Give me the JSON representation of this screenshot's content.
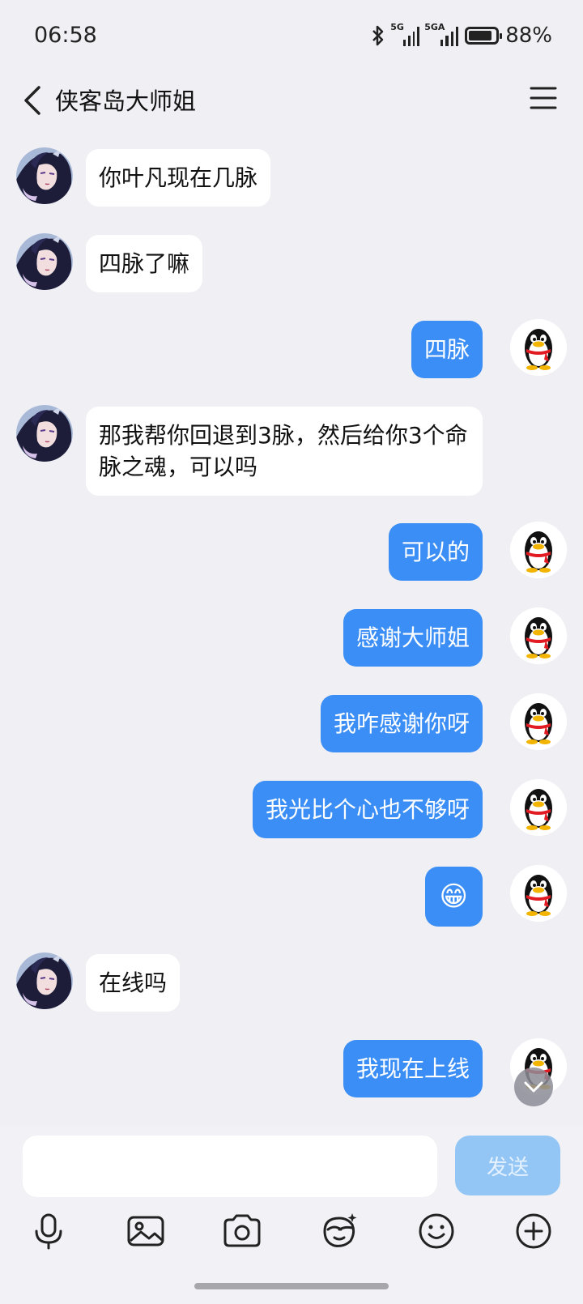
{
  "status_bar": {
    "time": "06:58",
    "signal1_label": "5G",
    "signal2_label": "5GA",
    "battery": "88%",
    "battery_level": 0.88
  },
  "header": {
    "title": "侠客岛大师姐",
    "back_icon": "chevron-left-icon",
    "menu_icon": "hamburger-menu-icon"
  },
  "messages": [
    {
      "side": "in",
      "text": "你叶凡现在几脉"
    },
    {
      "side": "in",
      "text": "四脉了嘛"
    },
    {
      "side": "out",
      "text": "四脉"
    },
    {
      "side": "in",
      "text": "那我帮你回退到3脉，然后给你3个命脉之魂，可以吗"
    },
    {
      "side": "out",
      "text": "可以的"
    },
    {
      "side": "out",
      "text": "感谢大师姐"
    },
    {
      "side": "out",
      "text": "我咋感谢你呀"
    },
    {
      "side": "out",
      "text": "我光比个心也不够呀"
    },
    {
      "side": "out",
      "text": "😁",
      "emoji": "grinning-face-emoji"
    },
    {
      "side": "in",
      "text": "在线吗"
    },
    {
      "side": "out",
      "text": "我现在上线"
    }
  ],
  "composer": {
    "input_value": "",
    "send_label": "发送",
    "tools": [
      "microphone-icon",
      "image-icon",
      "camera-icon",
      "sticker-icon",
      "emoji-icon",
      "plus-icon"
    ]
  },
  "colors": {
    "background": "#efeff4",
    "outgoing_bubble": "#3b8ef5",
    "incoming_bubble": "#ffffff",
    "send_button_disabled": "#93c6f5"
  }
}
